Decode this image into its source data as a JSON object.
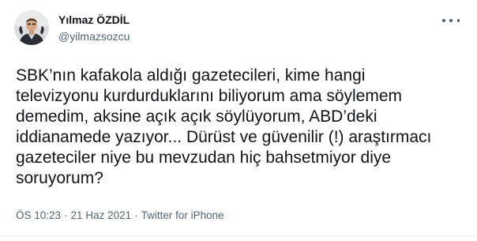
{
  "author": {
    "display_name": "Yılmaz ÖZDİL",
    "handle": "@yilmazsozcu"
  },
  "tweet": {
    "text": "SBK’nın kafakola aldığı gazetecileri, kime hangi\ntelevizyonu kurdurduklarını biliyorum ama söylemem\ndemedim, aksine açık açık söylüyorum, ABD’deki\niddianamede yazıyor... Dürüst ve güvenilir (!) araştırmacı\ngazeteciler niye bu mevzudan hiç bahsetmiyor diye\nsoruyorum?"
  },
  "meta": {
    "time": "ÖS 10:23",
    "separator": "·",
    "date": "21 Haz 2021",
    "source": "Twitter for iPhone"
  },
  "icons": {
    "avatar": "profile-photo",
    "more": "more-horizontal-icon"
  },
  "colors": {
    "text": "#0f1419",
    "secondary": "#536471",
    "background": "#ffffff"
  }
}
